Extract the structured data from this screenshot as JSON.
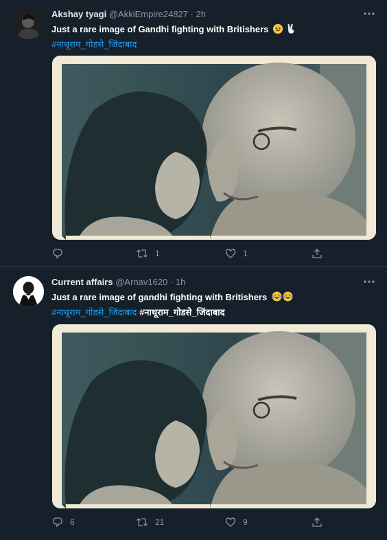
{
  "tweets": [
    {
      "name": "Akshay tyagi",
      "handle": "@AkkiEmpire24827",
      "dot": "·",
      "time": "2h",
      "text": "Just a rare image of Gandhi fighting with Britishers",
      "emojis": [
        "grinning-squinting-face",
        "victory-hand"
      ],
      "hashtags": [
        "#नाथूराम_गोडसे_जिंदाबाद"
      ],
      "plain_hashtags": [],
      "counts": {
        "reply": "",
        "retweet": "1",
        "like": "1"
      }
    },
    {
      "name": "Current affairs",
      "handle": "@Arnav1620",
      "dot": "·",
      "time": "1h",
      "text": "Just a rare image of gandhi fighting with Britishers",
      "emojis": [
        "tears-of-joy-face",
        "tears-of-joy-face"
      ],
      "hashtags": [
        "#नाथूराम_गोडसे_जिंदाबाद"
      ],
      "plain_hashtags": [
        "#नाथूराम_गोडसे_जिंदाबाद"
      ],
      "counts": {
        "reply": "6",
        "retweet": "21",
        "like": "9"
      }
    }
  ],
  "colors": {
    "background": "#15202b",
    "divider": "#38444d",
    "link": "#1d9bf0",
    "secondary_text": "#8b98a5"
  },
  "icons": [
    "avatar",
    "more-icon",
    "reply-icon",
    "retweet-icon",
    "like-icon",
    "share-icon"
  ]
}
